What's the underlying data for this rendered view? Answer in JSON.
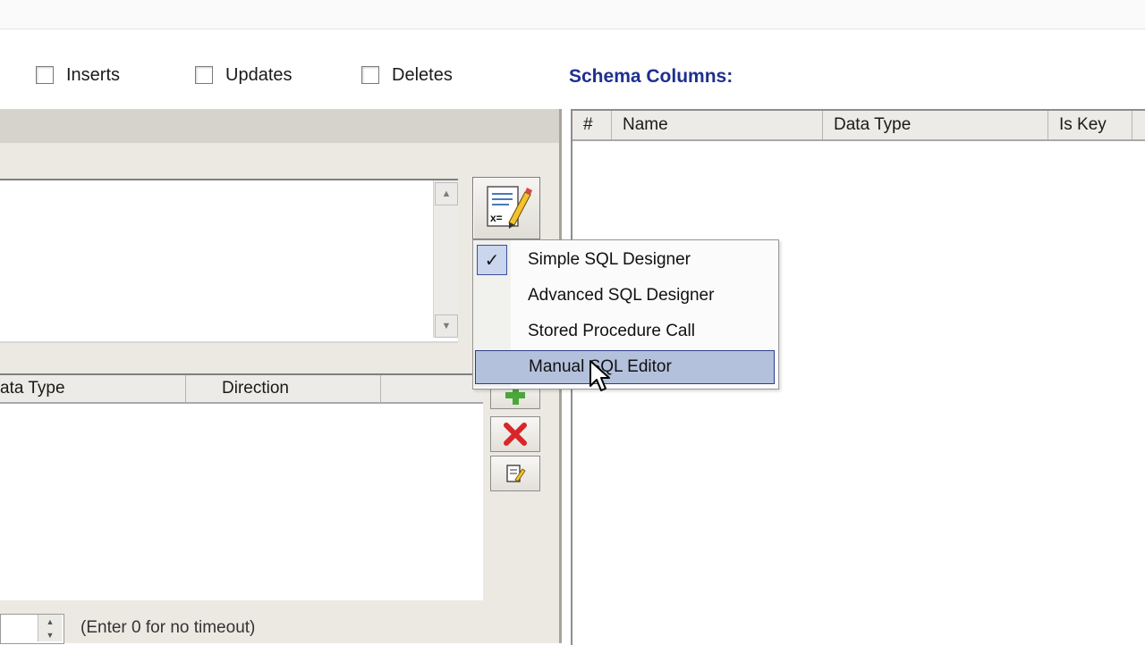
{
  "filters": {
    "inserts_label": "Inserts",
    "updates_label": "Updates",
    "deletes_label": "Deletes"
  },
  "schema": {
    "title": "Schema Columns:",
    "columns": [
      "#",
      "Name",
      "Data Type",
      "Is Key"
    ]
  },
  "parameters": {
    "columns": [
      "ata Type",
      "Direction",
      ""
    ]
  },
  "menu": {
    "items": [
      {
        "label": "Simple SQL Designer",
        "checked": true
      },
      {
        "label": "Advanced SQL Designer",
        "checked": false
      },
      {
        "label": "Stored Procedure Call",
        "checked": false
      },
      {
        "label": "Manual SQL Editor",
        "checked": false,
        "highlighted": true
      }
    ]
  },
  "timeout": {
    "hint": "(Enter 0 for no timeout)"
  },
  "icons": {
    "editor": "sql-editor-pencil-icon",
    "add": "green-plus-icon",
    "delete": "red-x-icon",
    "edit": "edit-note-icon",
    "check": "checkmark-icon",
    "cursor": "mouse-pointer-icon"
  },
  "colors": {
    "schema_title": "#1f2f8f",
    "menu_highlight": "#b4c1dd",
    "menu_highlight_border": "#2f3d88",
    "delete_red": "#d9262a",
    "add_green": "#4aa83a"
  }
}
